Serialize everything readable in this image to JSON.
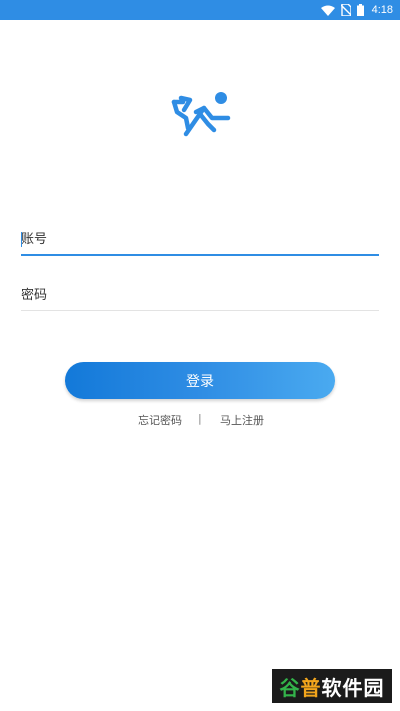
{
  "status_bar": {
    "time": "4:18",
    "icons": [
      "wifi-icon",
      "no-sim-icon",
      "battery-icon"
    ]
  },
  "logo": {
    "icon": "runner-logo-icon",
    "color": "#2f8de4"
  },
  "form": {
    "account_placeholder": "账号",
    "password_placeholder": "密码",
    "login_label": "登录"
  },
  "links": {
    "forgot": "忘记密码",
    "divider": "|",
    "register": "马上注册"
  },
  "watermark": {
    "part1": "谷",
    "part2": "普",
    "part3": "软件园"
  },
  "colors": {
    "accent": "#2f8de4",
    "status_bar": "#2f8de4",
    "button_gradient_start": "#1379d9",
    "button_gradient_end": "#4aaaf0"
  }
}
